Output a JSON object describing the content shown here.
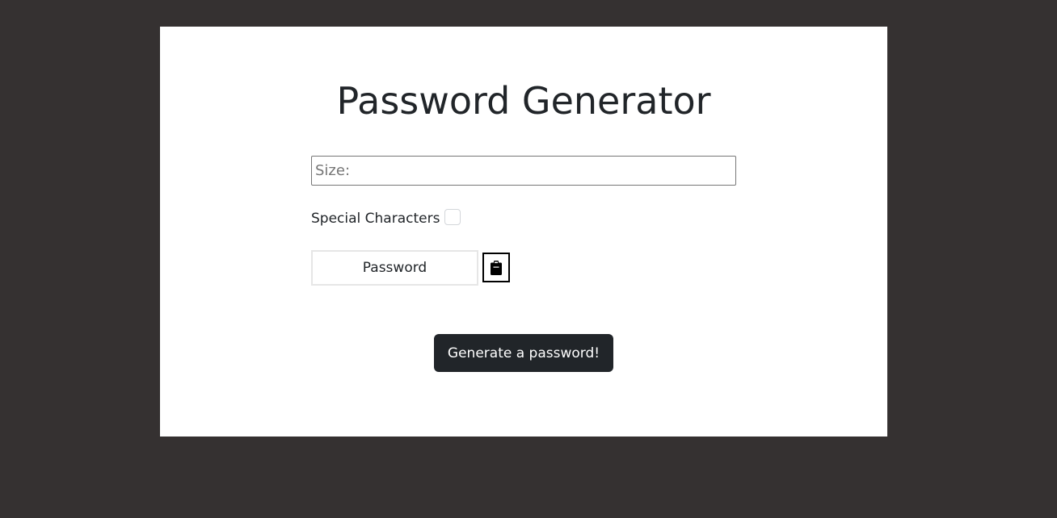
{
  "app": {
    "title": "Password Generator"
  },
  "form": {
    "size_placeholder": "Size:",
    "size_value": "",
    "special_label": "Special Characters",
    "special_checked": false,
    "password_text": "Password",
    "copy_icon": "clipboard-icon",
    "generate_label": "Generate a password!"
  },
  "colors": {
    "background": "#353131",
    "card": "#ffffff",
    "text": "#212529",
    "button": "#212529",
    "button_text": "#ffffff"
  }
}
